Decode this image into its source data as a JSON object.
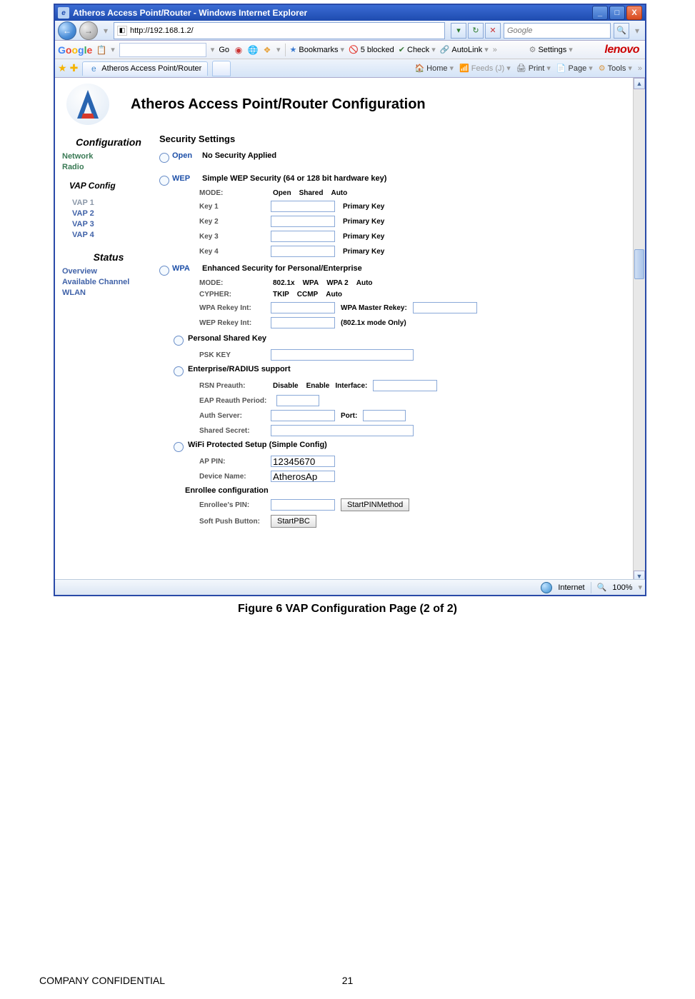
{
  "window": {
    "title": "Atheros Access Point/Router  - Windows Internet Explorer",
    "url": "http://192.168.1.2/",
    "search_placeholder": "Google"
  },
  "google_toolbar": {
    "go": "Go",
    "bookmarks": "Bookmarks",
    "blocked": "5 blocked",
    "check": "Check",
    "autolink": "AutoLink",
    "settings": "Settings",
    "brand": "lenovo"
  },
  "tabbar": {
    "tab_title": "Atheros Access Point/Router",
    "home": "Home",
    "feeds": "Feeds (J)",
    "print": "Print",
    "page": "Page",
    "tools": "Tools"
  },
  "content": {
    "page_heading": "Atheros Access Point/Router Configuration",
    "sidebar": {
      "configuration": "Configuration",
      "network": "Network",
      "radio": "Radio",
      "vap_config": "VAP Config",
      "vap1": "VAP 1",
      "vap2": "VAP 2",
      "vap3": "VAP 3",
      "vap4": "VAP 4",
      "status": "Status",
      "overview": "Overview",
      "available_channel": "Available Channel",
      "wlan": "WLAN"
    },
    "security": {
      "heading": "Security Settings",
      "open": {
        "label": "Open",
        "desc": "No Security Applied"
      },
      "wep": {
        "label": "WEP",
        "desc": "Simple WEP Security (64 or 128 bit hardware key)",
        "mode": "MODE:",
        "mode_open": "Open",
        "mode_shared": "Shared",
        "mode_auto": "Auto",
        "key1": "Key 1",
        "key2": "Key 2",
        "key3": "Key 3",
        "key4": "Key 4",
        "primary": "Primary Key"
      },
      "wpa": {
        "label": "WPA",
        "desc": "Enhanced Security for Personal/Enterprise",
        "mode": "MODE:",
        "mode_8021x": "802.1x",
        "mode_wpa": "WPA",
        "mode_wpa2": "WPA 2",
        "mode_auto": "Auto",
        "cypher": "CYPHER:",
        "tkip": "TKIP",
        "ccmp": "CCMP",
        "auto": "Auto",
        "wpa_rekey": "WPA Rekey Int:",
        "wpa_master": "WPA Master Rekey:",
        "wep_rekey": "WEP Rekey Int:",
        "wep_rekey_note": "(802.1x mode Only)"
      },
      "psk": {
        "label": "Personal Shared Key",
        "psk_key": "PSK KEY"
      },
      "radius": {
        "label": "Enterprise/RADIUS support",
        "preauth": "RSN Preauth:",
        "disable": "Disable",
        "enable": "Enable",
        "interface": "Interface:",
        "eap": "EAP Reauth Period:",
        "auth_server": "Auth Server:",
        "port": "Port:",
        "secret": "Shared Secret:"
      },
      "wps": {
        "label": "WiFi Protected Setup (Simple Config)",
        "ap_pin": "AP PIN:",
        "ap_pin_val": "12345670",
        "devname": "Device Name:",
        "devname_val": "AtherosAp",
        "enrollee_head": "Enrollee configuration",
        "enrollee_pin": "Enrollee's PIN:",
        "start_pin": "StartPINMethod",
        "pbc": "Soft Push Button:",
        "start_pbc": "StartPBC"
      }
    }
  },
  "statusbar": {
    "zone": "Internet",
    "zoom": "100%"
  },
  "caption": "Figure 6 VAP Configuration Page (2 of 2)",
  "footer": "COMPANY CONFIDENTIAL",
  "page_number": "21"
}
